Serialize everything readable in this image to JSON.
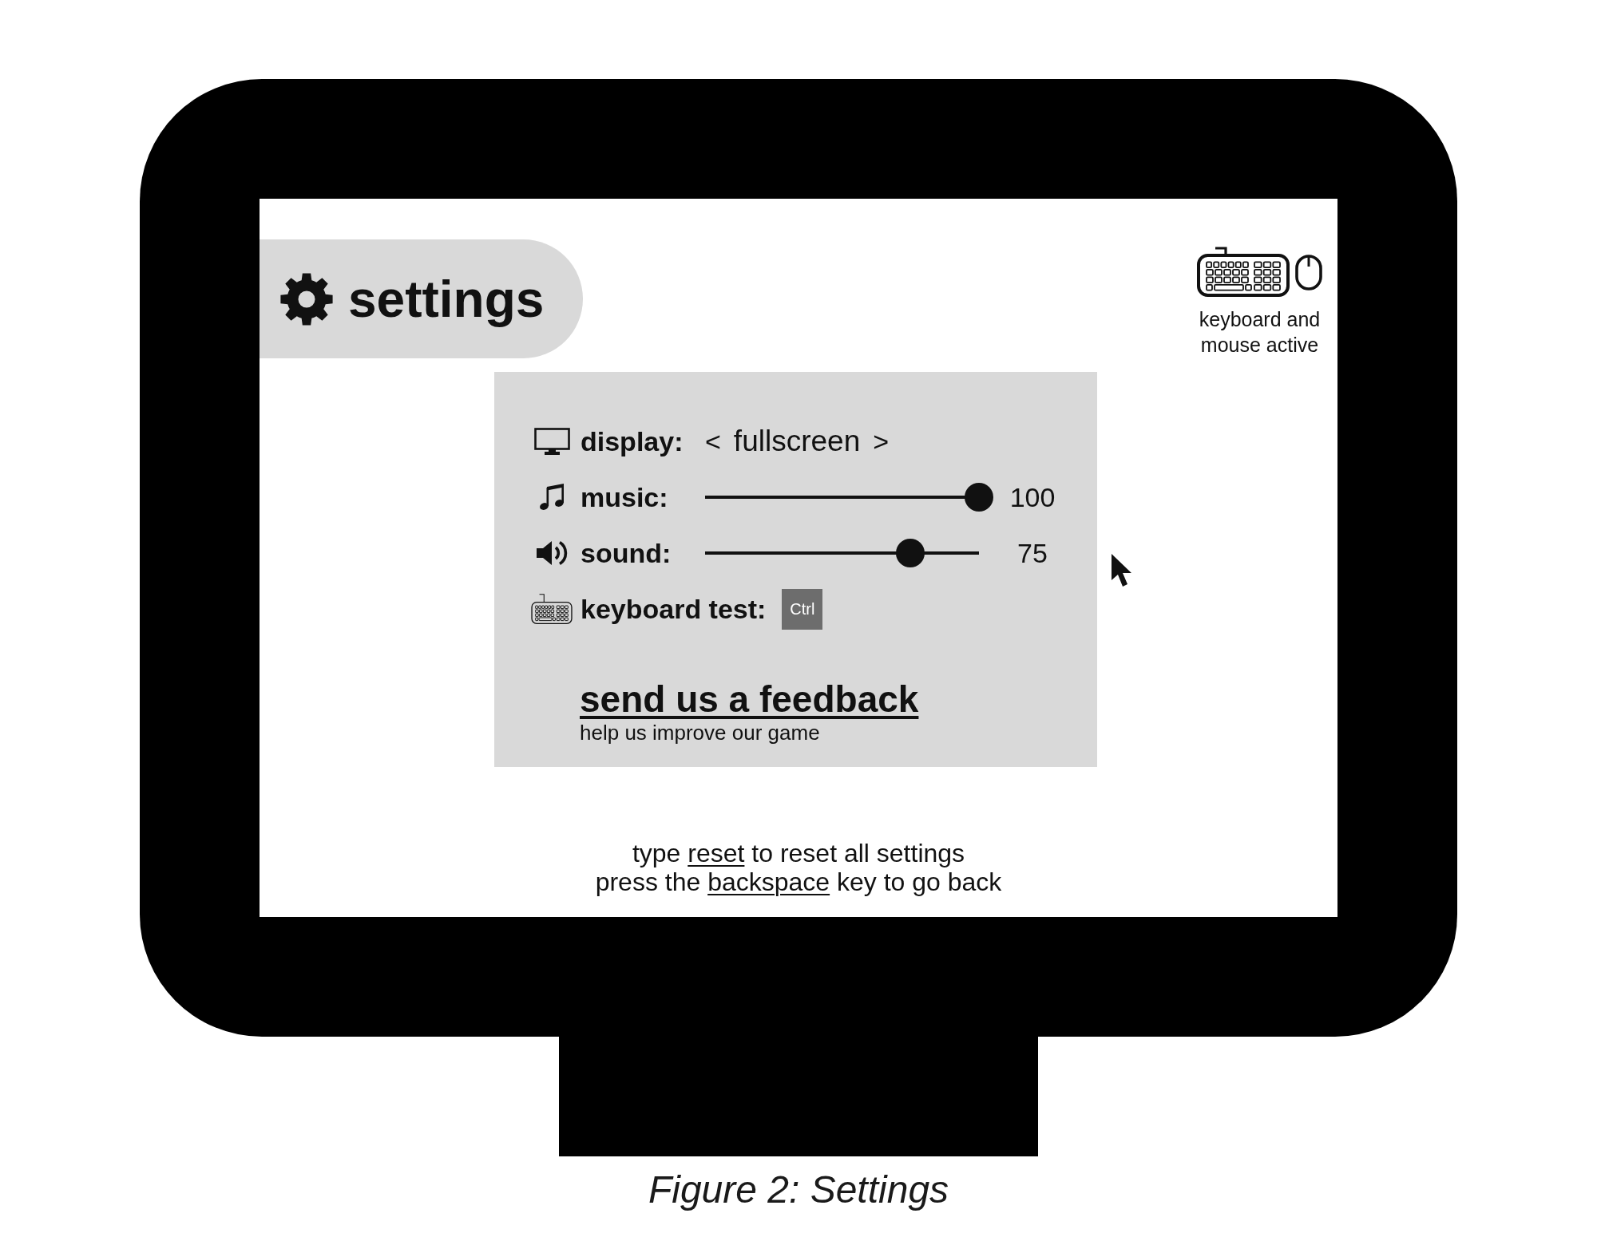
{
  "monitor": {
    "header": {
      "title": "settings"
    },
    "input_status": {
      "lines": [
        "keyboard and",
        "mouse active"
      ]
    },
    "settings_panel": {
      "rows": [
        {
          "kind": "choice",
          "label": "display:",
          "previous": "<",
          "value": "fullscreen",
          "next": ">"
        },
        {
          "kind": "slider",
          "label": "music:",
          "level": 1,
          "reading": "100"
        },
        {
          "kind": "slider",
          "label": "sound:",
          "level": 0.75,
          "reading": "75"
        },
        {
          "kind": "key_test",
          "label": "keyboard test:",
          "key": "Ctrl"
        }
      ],
      "feedback": {
        "link": "send us a feedback",
        "subtitle": "help us improve our game"
      }
    },
    "instructions": [
      {
        "before": "type ",
        "keyword": "reset",
        "after": " to reset all settings"
      },
      {
        "before": "press the ",
        "keyword": "backspace",
        "after": " key to go back"
      }
    ]
  },
  "caption": "Figure 2: Settings"
}
